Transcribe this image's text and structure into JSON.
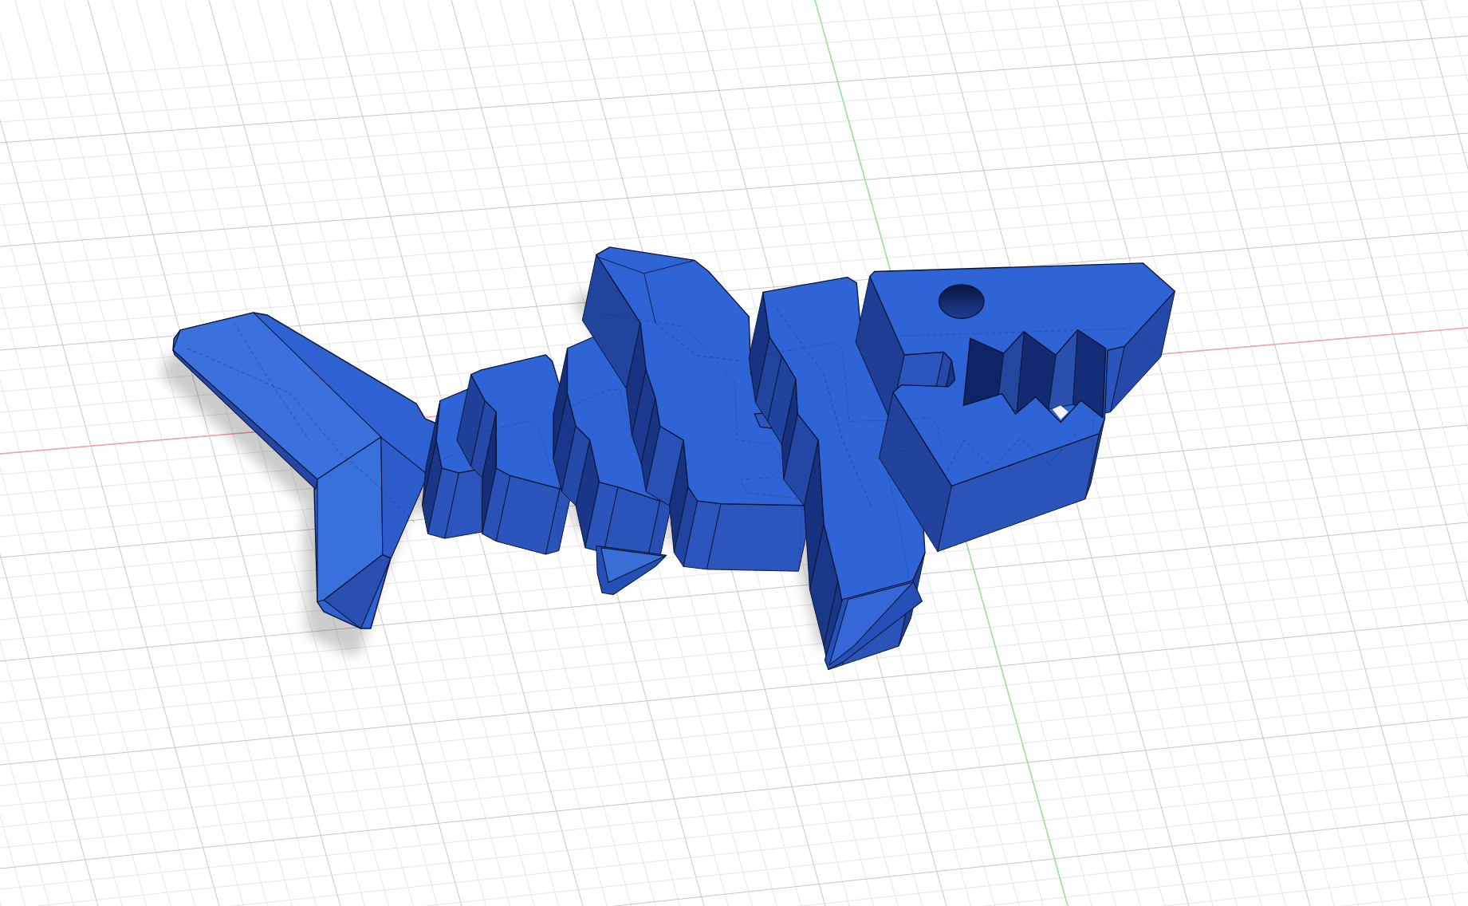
{
  "viewport": {
    "axes": [
      {
        "kind": "x",
        "color": "#f2a3a3"
      },
      {
        "kind": "y",
        "color": "#8ee68e"
      }
    ],
    "model": {
      "kind": "shark"
    }
  }
}
